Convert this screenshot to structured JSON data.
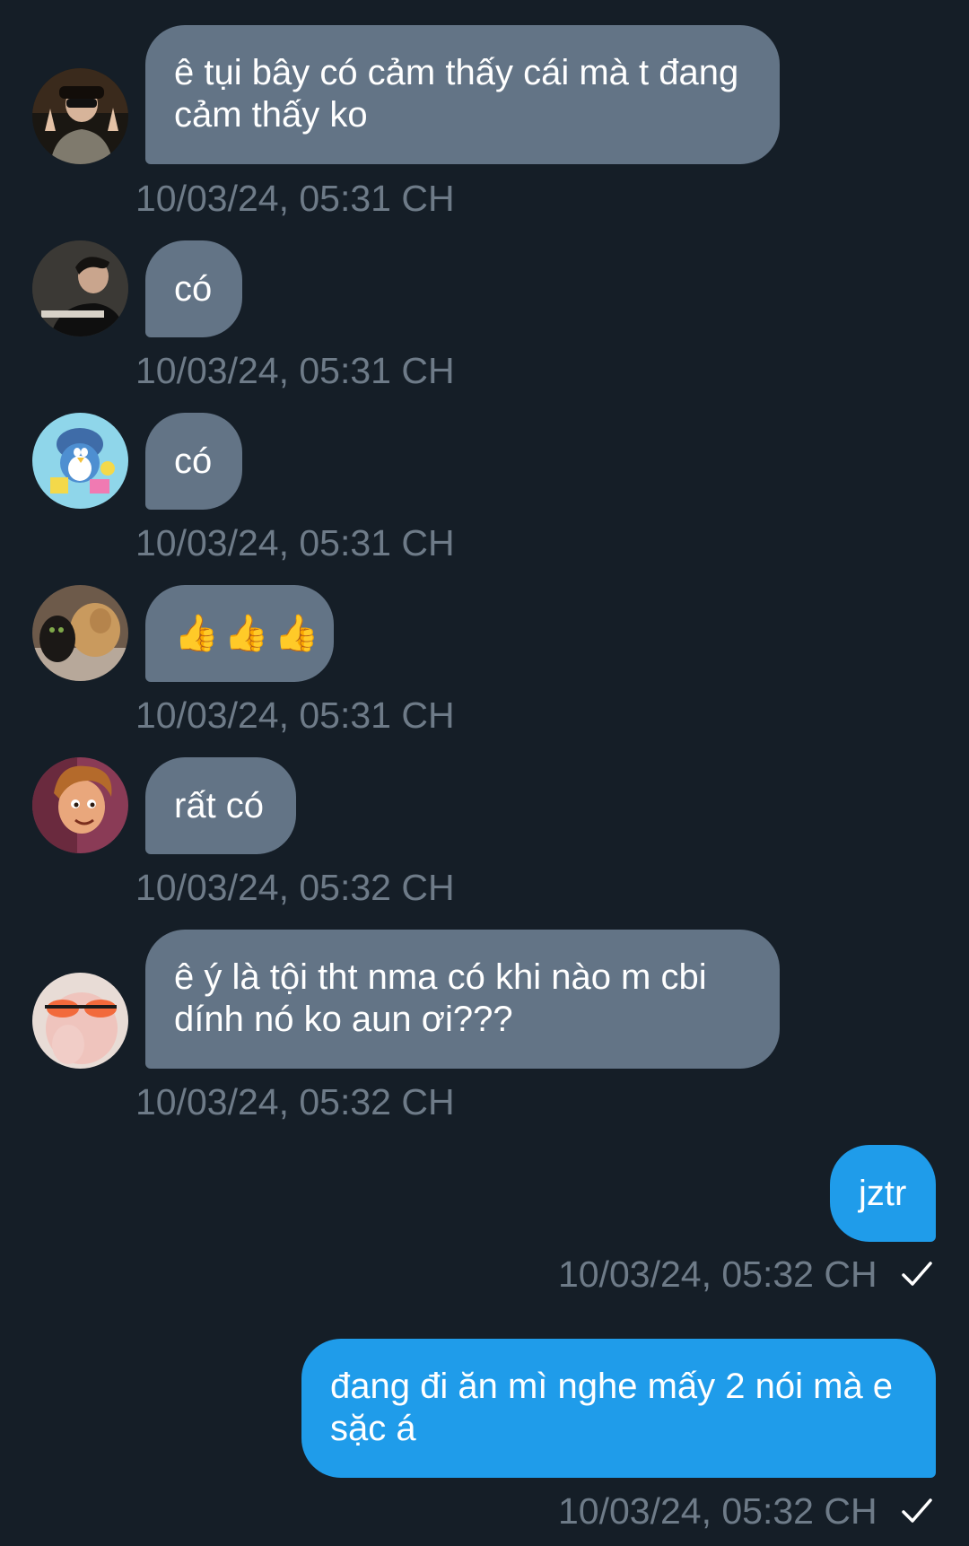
{
  "messages": [
    {
      "direction": "in",
      "avatar": "avatar-boy-sunglasses",
      "text": "ê tụi bây có cảm thấy cái mà t đang cảm thấy ko",
      "time": "10/03/24, 05:31 CH"
    },
    {
      "direction": "in",
      "avatar": "avatar-boy-desk",
      "text": "có",
      "time": "10/03/24, 05:31 CH"
    },
    {
      "direction": "in",
      "avatar": "avatar-cartoon-penguin",
      "text": "có",
      "time": "10/03/24, 05:31 CH"
    },
    {
      "direction": "in",
      "avatar": "avatar-dog-cat",
      "emoji": [
        "👍",
        "👍",
        "👍"
      ],
      "emoji_icon": "thumbs-up-icon",
      "time": "10/03/24, 05:31 CH"
    },
    {
      "direction": "in",
      "avatar": "avatar-cartoon-boy",
      "text": "rất có",
      "time": "10/03/24, 05:32 CH"
    },
    {
      "direction": "in",
      "avatar": "avatar-girl-orange-glasses",
      "text": "ê ý là tội tht nma có khi nào m cbi dính nó ko aun ơi???",
      "time": "10/03/24, 05:32 CH"
    },
    {
      "direction": "out",
      "text": "jztr",
      "time": "10/03/24, 05:32 CH",
      "status_icon": "checkmark-icon"
    },
    {
      "direction": "out",
      "text": "đang đi ăn mì nghe mấy 2 nói mà e sặc á",
      "time": "10/03/24, 05:32 CH",
      "status_icon": "checkmark-icon"
    }
  ],
  "colors": {
    "background": "#151e27",
    "incoming_bubble": "#637486",
    "outgoing_bubble": "#1f9cea",
    "timestamp": "#6e7b88",
    "text": "#ffffff"
  }
}
